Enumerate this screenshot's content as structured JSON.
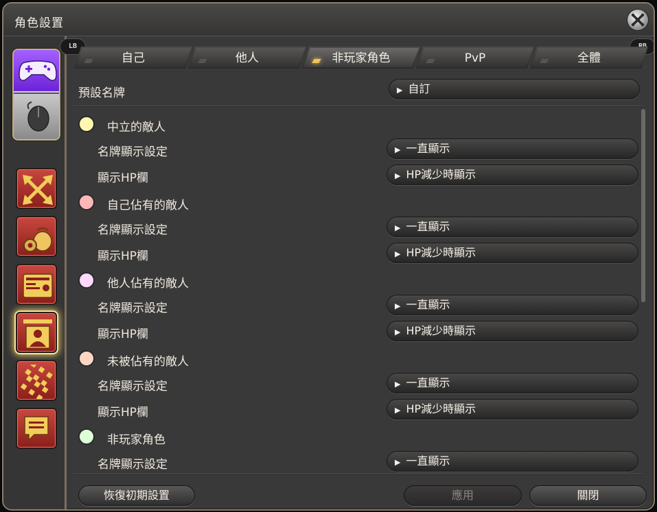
{
  "window": {
    "title": "角色設置"
  },
  "shoulders": {
    "left": "LB",
    "right": "RB"
  },
  "tabs": [
    {
      "label": "自己",
      "active": false
    },
    {
      "label": "他人",
      "active": false
    },
    {
      "label": "非玩家角色",
      "active": true
    },
    {
      "label": "PvP",
      "active": false
    },
    {
      "label": "全體",
      "active": false
    }
  ],
  "preset": {
    "label": "預設名牌",
    "value": "自訂"
  },
  "groups": [
    {
      "label": "中立的敵人",
      "color": "#fff7b0",
      "settings": [
        {
          "label": "名牌顯示設定",
          "value": "一直顯示"
        },
        {
          "label": "顯示HP欄",
          "value": "HP減少時顯示"
        }
      ]
    },
    {
      "label": "自己佔有的敵人",
      "color": "#ffb6b6",
      "settings": [
        {
          "label": "名牌顯示設定",
          "value": "一直顯示"
        },
        {
          "label": "顯示HP欄",
          "value": "HP減少時顯示"
        }
      ]
    },
    {
      "label": "他人佔有的敵人",
      "color": "#ffd8ff",
      "settings": [
        {
          "label": "名牌顯示設定",
          "value": "一直顯示"
        },
        {
          "label": "顯示HP欄",
          "value": "HP減少時顯示"
        }
      ]
    },
    {
      "label": "未被佔有的敵人",
      "color": "#ffd6c4",
      "settings": [
        {
          "label": "名牌顯示設定",
          "value": "一直顯示"
        },
        {
          "label": "顯示HP欄",
          "value": "HP減少時顯示"
        }
      ]
    },
    {
      "label": "非玩家角色",
      "color": "#ddffd8",
      "settings": [
        {
          "label": "名牌顯示設定",
          "value": "一直顯示"
        }
      ]
    }
  ],
  "footer": {
    "reset_label": "恢復初期設置",
    "apply_label": "應用",
    "close_label": "關閉"
  },
  "categories": [
    "move-arrows-icon",
    "gear-bag-icon",
    "id-card-icon",
    "nameplate-icon",
    "checker-icon",
    "chat-icon"
  ]
}
